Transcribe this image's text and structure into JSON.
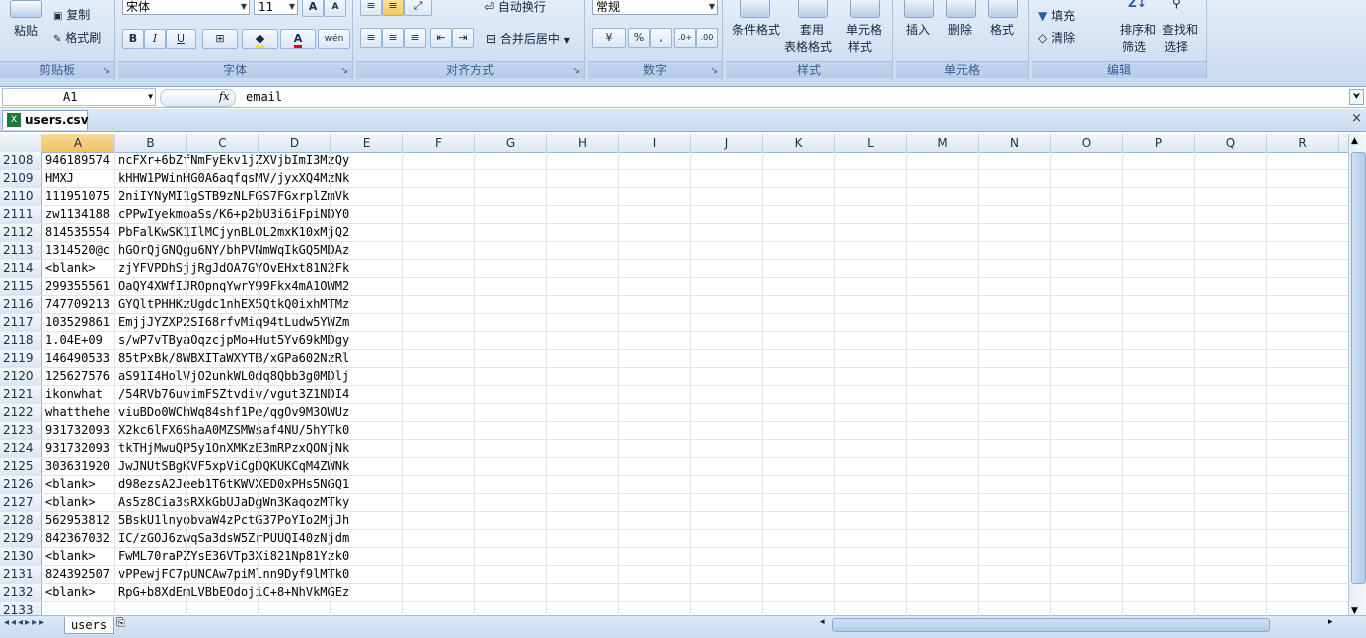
{
  "ribbon": {
    "clipboard": {
      "paste": "粘贴",
      "copy": "复制",
      "format_painter": "格式刷",
      "label": "剪贴板"
    },
    "font": {
      "name": "宋体",
      "size": "11",
      "label": "字体",
      "bold": "B",
      "italic": "I",
      "underline": "U",
      "grow": "A",
      "shrink": "A",
      "phonetic": "wén"
    },
    "alignment": {
      "wrap_text": "自动换行",
      "merge_center": "合并后居中",
      "label": "对齐方式"
    },
    "number": {
      "format": "常规",
      "percent": "%",
      "comma": ",",
      "label": "数字"
    },
    "styles": {
      "conditional": "条件格式",
      "table_format_1": "套用",
      "table_format_2": "表格格式",
      "cell_styles_1": "单元格",
      "cell_styles_2": "样式",
      "label": "样式"
    },
    "cells": {
      "insert": "插入",
      "delete": "删除",
      "format": "格式",
      "label": "单元格"
    },
    "editing": {
      "fill": "填充",
      "clear": "清除",
      "sort_1": "排序和",
      "sort_2": "筛选",
      "find_1": "查找和",
      "find_2": "选择",
      "label": "编辑"
    }
  },
  "formula_bar": {
    "name_box": "A1",
    "fx": "fx",
    "content": "email"
  },
  "workbook": {
    "tab_title": "users.csv",
    "close": "×",
    "sheet_tab": "users"
  },
  "columns": [
    "A",
    "B",
    "C",
    "D",
    "E",
    "F",
    "G",
    "H",
    "I",
    "J",
    "K",
    "L",
    "M",
    "N",
    "O",
    "P",
    "Q",
    "R"
  ],
  "rows": [
    {
      "n": "2108",
      "a": "946189574",
      "b": "ncFXr+6bZfNmFyEkv1jZXVjbImI3MzQy"
    },
    {
      "n": "2109",
      "a": "HMXJ",
      "b": "kHHW1PWinHG0A6aqfqsMV/jyxXQ4MzNk"
    },
    {
      "n": "2110",
      "a": "111951075",
      "b": "2niIYNyMI1gSTB9zNLFGS7FGxrplZmVk"
    },
    {
      "n": "2111",
      "a": "zw1134188",
      "b": "cPPwIyekmoaSs/K6+p2bU3i6iFpiNDY0"
    },
    {
      "n": "2112",
      "a": "814535554",
      "b": "PbFalKwSK1IlMCjynBLOL2mxK10xMjQ2"
    },
    {
      "n": "2113",
      "a": "1314520@c",
      "b": "hGOrQjGNQgu6NY/bhPVNmWqIkGQ5MDAz"
    },
    {
      "n": "2114",
      "a": "<blank>",
      "b": "zjYFVPDhSjjRgJdOA7GYOvEHxt81N2Fk"
    },
    {
      "n": "2115",
      "a": "299355561",
      "b": "OaQY4XWfIJROpnqYwrY99Fkx4mA1OWM2"
    },
    {
      "n": "2116",
      "a": "747709213",
      "b": "GYQltPHHKzUgdc1nhEX5QtkQ0ixhMTMz"
    },
    {
      "n": "2117",
      "a": "103529861",
      "b": "EmjjJYZXP2SI68rfvMiq94tLudw5YWZm"
    },
    {
      "n": "2118",
      "a": "1.04E+09",
      "b": "s/wP7vTByaOqzcjpMo+Hut5Yv69kMDgy"
    },
    {
      "n": "2119",
      "a": "146490533",
      "b": "85tPxBk/8WBXITaWXYTB/xGPa602NzRl"
    },
    {
      "n": "2120",
      "a": "125627576",
      "b": "aS91I4HolVjO2unkWL0dq8Qbb3g0MDlj"
    },
    {
      "n": "2121",
      "a": "ikonwhat",
      "b": "/54RVb76uvimFSZtvdiv/vgut3Z1NDI4"
    },
    {
      "n": "2122",
      "a": "whatthehe",
      "b": "viuBDo0WChWq84shf1Pe/qgOv9M3OWUz"
    },
    {
      "n": "2123",
      "a": "931732093",
      "b": "X2kc6lFX6ShaA0MZSMWsaf4NU/5hYTk0"
    },
    {
      "n": "2124",
      "a": "931732093",
      "b": "tkTHjMwuQP5y1OnXMKzE3mRPzxQONjNk"
    },
    {
      "n": "2125",
      "a": "303631920",
      "b": "JwJNUtSBgKVF5xpViCgDQKUKCqM4ZWNk"
    },
    {
      "n": "2126",
      "a": "<blank>",
      "b": "d98ezsA2Jeeb1T6tKWVXED0xPHs5NGQ1"
    },
    {
      "n": "2127",
      "a": "<blank>",
      "b": "As5z8Cia3sRXkGbUJaDgWn3KaqozMTky"
    },
    {
      "n": "2128",
      "a": "562953812",
      "b": "5BskU1lnyobvaW4zPctG37PoYIo2MjJh"
    },
    {
      "n": "2129",
      "a": "842367032",
      "b": "IC/zGOJ6zwqSa3dsW5ZrPUUQI40zNjdm"
    },
    {
      "n": "2130",
      "a": "<blank>",
      "b": "FwML70raPZYsE36VTp3Xi821Np81Yzk0"
    },
    {
      "n": "2131",
      "a": "824392507",
      "b": "vPPewjFC7pUNCAw7piMlnn9Dyf9lMTk0"
    },
    {
      "n": "2132",
      "a": "<blank>",
      "b": "RpG+b8XdEmLVBbEOdojiC+8+NhVkMGEz"
    },
    {
      "n": "2133",
      "a": "",
      "b": ""
    }
  ]
}
